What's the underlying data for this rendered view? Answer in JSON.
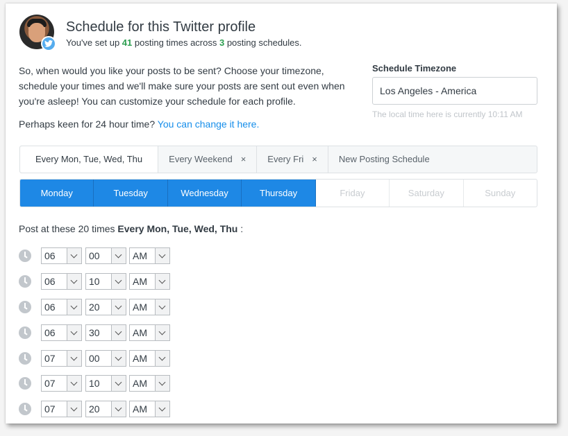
{
  "header": {
    "title": "Schedule for this Twitter profile",
    "subtitle_prefix": "You've set up ",
    "posting_times": "41",
    "subtitle_mid": " posting times across ",
    "schedules_count": "3",
    "subtitle_suffix": " posting schedules."
  },
  "intro": {
    "text": "So, when would you like your posts to be sent? Choose your timezone, schedule your times and we'll make sure your posts are sent out even when you're asleep! You can customize your schedule for each profile.",
    "hour_prefix": "Perhaps keen for 24 hour time? ",
    "hour_link": "You can change it here."
  },
  "timezone": {
    "label": "Schedule Timezone",
    "value": "Los Angeles - America",
    "note": "The local time here is currently 10:11 AM"
  },
  "schedule_tabs": [
    {
      "label": "Every Mon, Tue, Wed, Thu",
      "active": true
    },
    {
      "label": "Every Weekend",
      "close": "×"
    },
    {
      "label": "Every Fri",
      "close": "×"
    },
    {
      "label": "New Posting Schedule"
    }
  ],
  "days": [
    {
      "label": "Monday",
      "on": true
    },
    {
      "label": "Tuesday",
      "on": true
    },
    {
      "label": "Wednesday",
      "on": true
    },
    {
      "label": "Thursday",
      "on": true
    },
    {
      "label": "Friday",
      "on": false
    },
    {
      "label": "Saturday",
      "on": false
    },
    {
      "label": "Sunday",
      "on": false
    }
  ],
  "post_at": {
    "prefix": "Post at these 20 times ",
    "schedule": "Every Mon, Tue, Wed, Thu",
    "suffix": " :"
  },
  "times": [
    {
      "hour": "06",
      "minute": "00",
      "ampm": "AM"
    },
    {
      "hour": "06",
      "minute": "10",
      "ampm": "AM"
    },
    {
      "hour": "06",
      "minute": "20",
      "ampm": "AM"
    },
    {
      "hour": "06",
      "minute": "30",
      "ampm": "AM"
    },
    {
      "hour": "07",
      "minute": "00",
      "ampm": "AM"
    },
    {
      "hour": "07",
      "minute": "10",
      "ampm": "AM"
    },
    {
      "hour": "07",
      "minute": "20",
      "ampm": "AM"
    }
  ],
  "colors": {
    "accent": "#1e88e5",
    "link": "#168eea",
    "green": "#2c9e50",
    "twitter": "#55acee"
  }
}
